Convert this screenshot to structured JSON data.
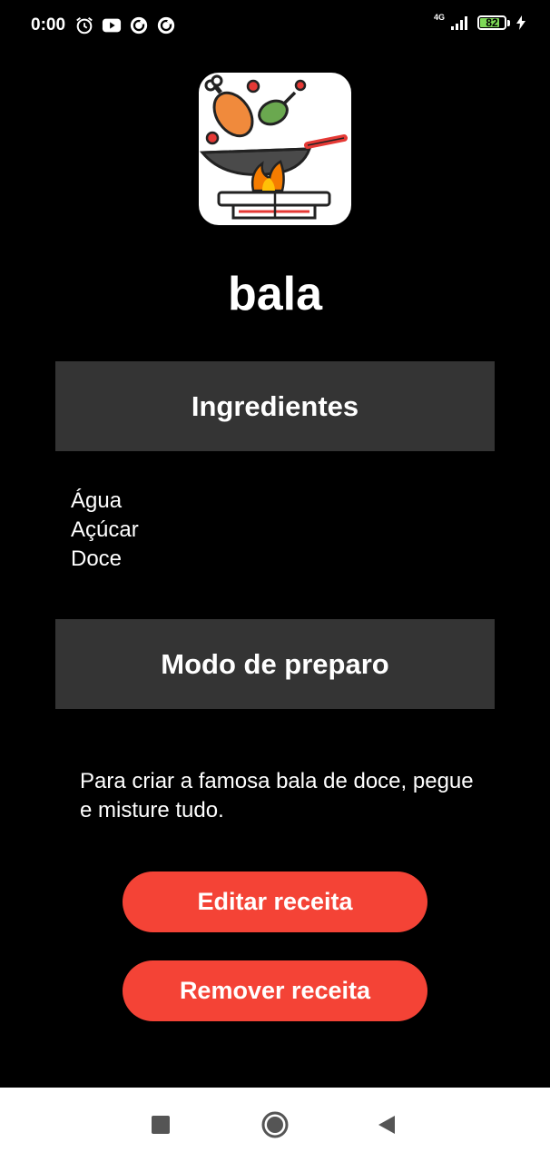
{
  "status_bar": {
    "time": "0:00",
    "notification_icons": [
      "alarm-icon",
      "youtube-icon",
      "sync-icon",
      "sync-icon"
    ],
    "network_label": "4G",
    "battery_level": "82",
    "battery_fraction": 0.82,
    "charging": true
  },
  "app": {
    "logo_icon": "wok-cooking-icon"
  },
  "recipe": {
    "title": "bala",
    "ingredients_header": "Ingredientes",
    "ingredients": [
      "Água",
      "Açúcar",
      "Doce"
    ],
    "method_header": "Modo de preparo",
    "method_text": "Para criar a famosa bala de doce, pegue e misture tudo."
  },
  "actions": {
    "edit_label": "Editar receita",
    "remove_label": "Remover receita"
  },
  "colors": {
    "background": "#000000",
    "section_header": "#343434",
    "button": "#f44336",
    "battery_fill": "#7ed957"
  },
  "nav_bar": {
    "items": [
      "recents-square-icon",
      "home-circle-icon",
      "back-triangle-icon"
    ]
  }
}
